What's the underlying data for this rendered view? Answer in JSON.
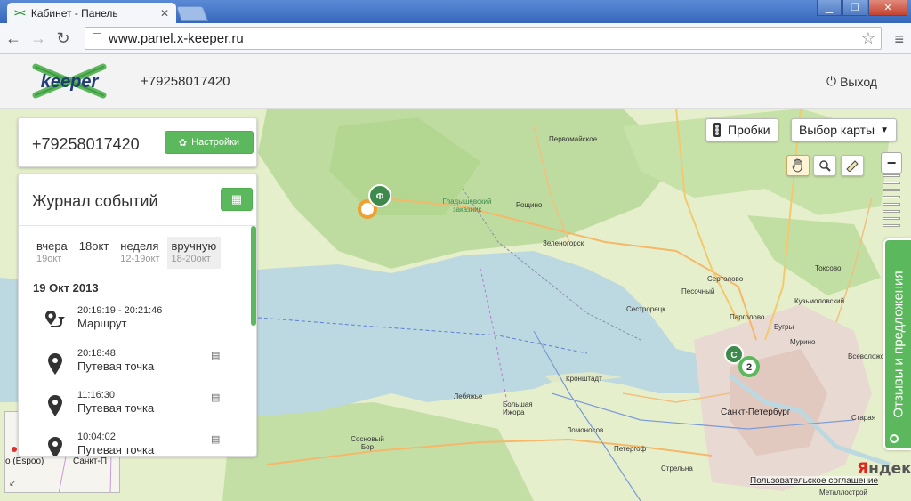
{
  "browser": {
    "tab_title": "Кабинет - Панель",
    "tab_favicon": "><",
    "url": "www.panel.x-keeper.ru",
    "back_icon": "←",
    "forward_icon": "→",
    "reload_icon": "↻",
    "star_icon": "☆",
    "menu_icon": "≡",
    "win_min": "▁",
    "win_max": "❐",
    "win_close": "✕"
  },
  "header": {
    "logo_text": "keeper",
    "phone": "+79258017420",
    "logout_label": "Выход",
    "logout_icon": "⏻"
  },
  "phone_panel": {
    "phone": "+79258017420",
    "settings_label": "Настройки",
    "settings_icon": "✿"
  },
  "journal": {
    "title": "Журнал событий",
    "calendar_icon": "▦",
    "periods": [
      {
        "label": "вчера",
        "sub": "19окт"
      },
      {
        "label": "18окт",
        "sub": ""
      },
      {
        "label": "неделя",
        "sub": "12-19окт"
      },
      {
        "label": "вручную",
        "sub": "18-20окт"
      }
    ],
    "date": "19 Окт 2013",
    "events": [
      {
        "time": "20:19:19 - 20:21:46",
        "type": "Маршрут",
        "icon": "route-icon"
      },
      {
        "time": "20:18:48",
        "type": "Путевая точка",
        "icon": "map-pin-icon"
      },
      {
        "time": "11:16:30",
        "type": "Путевая точка",
        "icon": "map-pin-icon"
      },
      {
        "time": "10:04:02",
        "type": "Путевая точка",
        "icon": "map-pin-icon"
      }
    ],
    "save_icon": "▤"
  },
  "map": {
    "traffic_label": "Пробки",
    "map_select_label": "Выбор карты",
    "map_select_arrow": "▼",
    "feedback_label": "Отзывы и предложения",
    "yandex_y": "Я",
    "yandex_rest": "ндекс",
    "terms": "Пользовательское соглашение",
    "minimap_label_1": "o (Espoo)",
    "minimap_label_2": "Санкт-П",
    "minimap_arrow": "↙",
    "labels": {
      "pervomayskoe": "Первомайское",
      "roshchino": "Рощино",
      "gladyshevsky": "Гладышевский заказник",
      "zelenogorsk": "Зеленогорск",
      "sertolovo": "Сертолово",
      "toksovo": "Токсово",
      "pesochny": "Песочный",
      "kuzmolovsky": "Кузьмоловский",
      "sestroretsk": "Сестрорецк",
      "pargolovo": "Парголово",
      "bugry": "Бугры",
      "murino": "Мурино",
      "vsevolozhsk": "Всеволожск",
      "kronshtadt": "Кронштадт",
      "spb": "Санкт-Петербург",
      "lebyazhye": "Лебяжье",
      "bolshaya_izhora": "Большая Ижора",
      "lomonosov": "Ломоносов",
      "sosnovy_bor": "Сосновый Бор",
      "petergof": "Петергоф",
      "strelna": "Стрельна",
      "staraya": "Старая",
      "metallostroy": "Металлострой",
      "marker_f": "Ф",
      "marker_c": "С",
      "cluster": "2"
    }
  },
  "colors": {
    "accent_green": "#5cb85c",
    "water": "#bcd8e0",
    "land": "#e6efcc",
    "forest": "#bfdca0"
  }
}
